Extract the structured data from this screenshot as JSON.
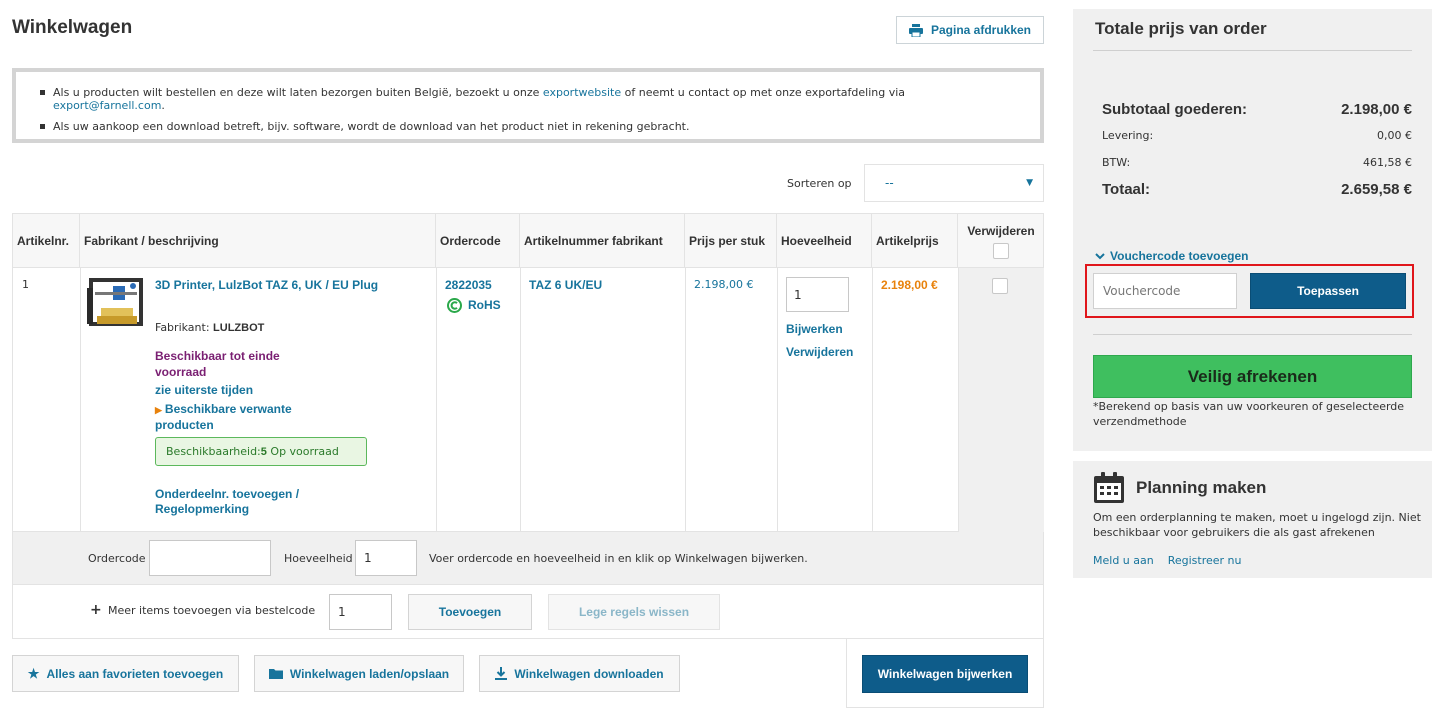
{
  "header": {
    "title": "Winkelwagen",
    "print_label": "Pagina afdrukken"
  },
  "notice": {
    "line1_pre": "Als u producten wilt bestellen en deze wilt laten bezorgen buiten België, bezoekt u onze ",
    "line1_link1": "exportwebsite",
    "line1_mid": " of neemt u contact op met onze exportafdeling via ",
    "line1_link2": "export@farnell.com",
    "line1_post": ".",
    "line2": "Als uw aankoop een download betreft, bijv. software, wordt de download van het product niet in rekening gebracht."
  },
  "sort": {
    "label": "Sorteren op",
    "value": "--"
  },
  "table": {
    "headers": {
      "item_no": "Artikelnr.",
      "description": "Fabrikant / beschrijving",
      "order_code": "Ordercode",
      "mfr_part": "Artikelnummer fabrikant",
      "unit_price": "Prijs per stuk",
      "quantity": "Hoeveelheid",
      "line_price": "Artikelprijs",
      "remove": "Verwijderen"
    },
    "rows": [
      {
        "item_no": "1",
        "name": "3D Printer, LulzBot TAZ 6, UK / EU Plug",
        "manufacturer_label": "Fabrikant:",
        "manufacturer": "LULZBOT",
        "availability": "Beschikbaar tot einde voorraad",
        "lead_times": "zie uiterste tijden",
        "related": "Beschikbare verwante producten",
        "stock_label": "Beschikbaarheid:",
        "stock_count": "5",
        "stock_status": "Op voorraad",
        "part_no_link": "Onderdeelnr. toevoegen / Regelopmerking",
        "order_code": "2822035",
        "rohs": "RoHS",
        "mfr_part": "TAZ 6 UK/EU",
        "unit_price": "2.198,00 €",
        "quantity": "1",
        "update": "Bijwerken",
        "delete": "Verwijderen",
        "line_price": "2.198,00 €"
      }
    ]
  },
  "quick_add": {
    "ordercode_label": "Ordercode",
    "ordercode_value": "",
    "qty_label": "Hoeveelheid",
    "qty_value": "1",
    "hint": "Voer ordercode en hoeveelheid in en klik op Winkelwagen bijwerken."
  },
  "bulk_add": {
    "label": "Meer items toevoegen via bestelcode",
    "qty_value": "1",
    "add_button": "Toevoegen",
    "clear_button": "Lege regels wissen"
  },
  "actions": {
    "favorites": "Alles aan favorieten toevoegen",
    "load_save": "Winkelwagen laden/opslaan",
    "download": "Winkelwagen downloaden",
    "update_cart": "Winkelwagen bijwerken"
  },
  "summary": {
    "title": "Totale prijs van order",
    "subtotal_label": "Subtotaal goederen:",
    "subtotal_value": "2.198,00 €",
    "delivery_label": "Levering:",
    "delivery_value": "0,00 €",
    "vat_label": "BTW:",
    "vat_value": "461,58 €",
    "total_label": "Totaal:",
    "total_value": "2.659,58 €",
    "voucher_toggle": "Vouchercode toevoegen",
    "voucher_placeholder": "Vouchercode",
    "voucher_apply": "Toepassen",
    "checkout": "Veilig afrekenen",
    "note": "*Berekend op basis van uw voorkeuren of geselecteerde verzendmethode"
  },
  "planning": {
    "title": "Planning maken",
    "text": "Om een orderplanning te maken, moet u ingelogd zijn. Niet beschikbaar voor gebruikers die als gast afrekenen",
    "login": "Meld u aan",
    "register": "Registreer nu"
  },
  "colors": {
    "link": "#17749c",
    "primary": "#0e5c8a",
    "checkout": "#3fbf5f",
    "price_accent": "#e8820c",
    "highlight_frame": "#e0161b"
  }
}
